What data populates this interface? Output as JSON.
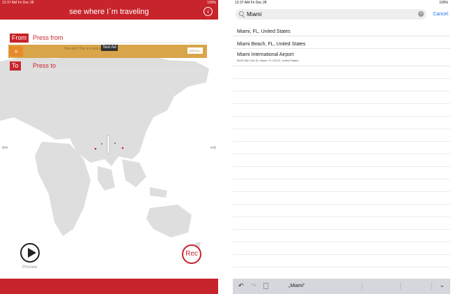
{
  "left": {
    "status": {
      "time": "12:37 AM  Fri Dec 28",
      "battery": "100%"
    },
    "title": "see where I`m traveling",
    "info_icon": "info-icon",
    "from_tag": "From",
    "from_text": "Press from",
    "to_tag": "To",
    "to_text": "Press to",
    "ad": {
      "label": "Test Ad",
      "install": "INSTALL",
      "text": "Nice job! This is a test ad."
    },
    "preview_label": "Preview",
    "rec_label": "Rec",
    "colors": {
      "accent": "#c8242b",
      "ad": "#d9a54a"
    }
  },
  "right": {
    "status": {
      "time": "12:37 AM  Fri Dec 28",
      "battery": "100%"
    },
    "search": {
      "value": "Miami"
    },
    "cancel": "Cancel",
    "results": [
      {
        "title": "Miami, FL, United States",
        "subtitle": ""
      },
      {
        "title": "Miami Beach, FL, United States",
        "subtitle": ""
      },
      {
        "title": "Miami International Airport",
        "subtitle": "5200 NW 21st St, Miami, FL  33122, United States"
      }
    ],
    "keyboard": {
      "suggestion": "„Miami“"
    }
  }
}
